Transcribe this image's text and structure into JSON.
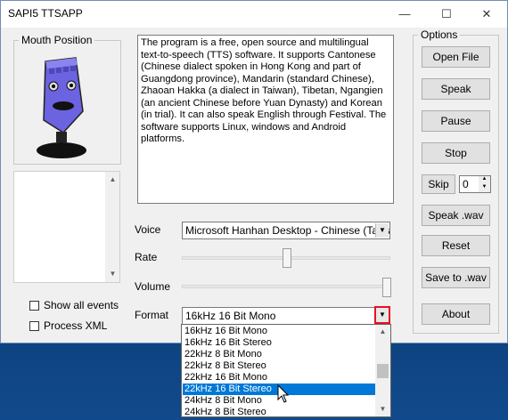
{
  "window": {
    "title": "SAPI5 TTSAPP"
  },
  "titlebar": {
    "minimize": "—",
    "maximize": "☐",
    "close": "✕"
  },
  "mouth_group": {
    "label": "Mouth Position"
  },
  "description_text": "The program is a free, open source and multilingual text-to-speech (TTS) software. It supports Cantonese (Chinese dialect spoken in Hong Kong and part of Guangdong province), Mandarin (standard Chinese), Zhaoan Hakka (a dialect in Taiwan), Tibetan, Ngangien (an ancient Chinese before Yuan Dynasty) and Korean (in trial). It can also speak English through Festival. The software supports Linux, windows and Android platforms.",
  "checkboxes": {
    "show_all_events": "Show all events",
    "process_xml": "Process XML"
  },
  "voice": {
    "label": "Voice",
    "value": "Microsoft Hanhan Desktop - Chinese (Taiwan)"
  },
  "rate": {
    "label": "Rate",
    "level": 0.5
  },
  "volume": {
    "label": "Volume",
    "level": 1.0
  },
  "format": {
    "label": "Format",
    "value": "16kHz 16 Bit Mono",
    "options": [
      "16kHz 16 Bit Mono",
      "16kHz 16 Bit Stereo",
      "22kHz 8 Bit Mono",
      "22kHz 8 Bit Stereo",
      "22kHz 16 Bit Mono",
      "22kHz 16 Bit Stereo",
      "24kHz 8 Bit Mono",
      "24kHz 8 Bit Stereo"
    ],
    "selected_index": 5
  },
  "options_group": {
    "label": "Options",
    "open_file": "Open File",
    "speak": "Speak",
    "pause": "Pause",
    "stop": "Stop",
    "skip": "Skip",
    "skip_value": "0",
    "speak_wav": "Speak .wav",
    "reset": "Reset",
    "save_to_wav": "Save to .wav",
    "about": "About"
  },
  "colors": {
    "highlight": "#0078d7",
    "dropdown_button_border": "#e81123",
    "mouth_face": "#6b63e0"
  }
}
